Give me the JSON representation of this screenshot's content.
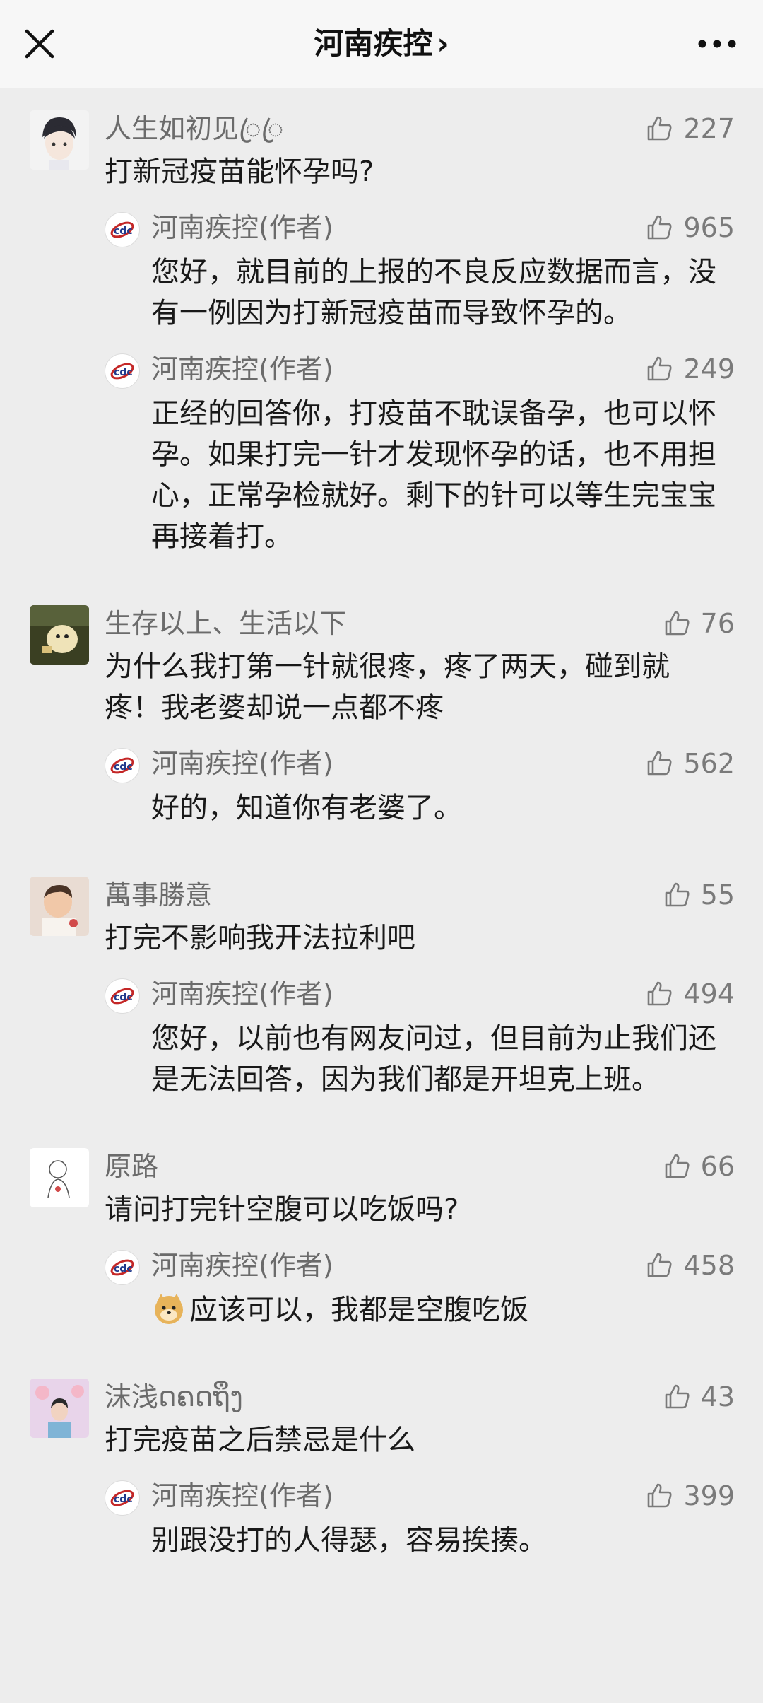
{
  "header": {
    "title": "河南疾控",
    "chevron": "›"
  },
  "colors": {
    "background": "#ededed",
    "header_bg": "#f7f7f7",
    "name_gray": "#6b6b6b",
    "text": "#191919"
  },
  "comments": [
    {
      "user": "人生如初见ꦿ⁣ꦿ",
      "likes": "227",
      "text": "打新冠疫苗能怀孕吗?",
      "replies": [
        {
          "user": "河南疾控(作者)",
          "likes": "965",
          "text": "您好，就目前的上报的不良反应数据而言，没有一例因为打新冠疫苗而导致怀孕的。"
        },
        {
          "user": "河南疾控(作者)",
          "likes": "249",
          "text": "正经的回答你，打疫苗不耽误备孕，也可以怀孕。如果打完一针才发现怀孕的话，也不用担心，正常孕检就好。剩下的针可以等生完宝宝再接着打。"
        }
      ]
    },
    {
      "user": "生存以上、生活以下",
      "likes": "76",
      "text": "为什么我打第一针就很疼，疼了两天，碰到就疼！我老婆却说一点都不疼",
      "replies": [
        {
          "user": "河南疾控(作者)",
          "likes": "562",
          "text": "好的，知道你有老婆了。"
        }
      ]
    },
    {
      "user": "萬事勝意",
      "likes": "55",
      "text": "打完不影响我开法拉利吧",
      "replies": [
        {
          "user": "河南疾控(作者)",
          "likes": "494",
          "text": "您好，以前也有网友问过，但目前为止我们还是无法回答，因为我们都是开坦克上班。"
        }
      ]
    },
    {
      "user": "原路",
      "likes": "66",
      "text": "请问打完针空腹可以吃饭吗?",
      "replies": [
        {
          "user": "河南疾控(作者)",
          "likes": "458",
          "text": "应该可以，我都是空腹吃饭"
        }
      ]
    },
    {
      "user": "沫浅ດຄດຖຶງ",
      "likes": "43",
      "text": "打完疫苗之后禁忌是什么",
      "replies": [
        {
          "user": "河南疾控(作者)",
          "likes": "399",
          "text": "别跟没打的人得瑟，容易挨揍。"
        }
      ]
    }
  ]
}
